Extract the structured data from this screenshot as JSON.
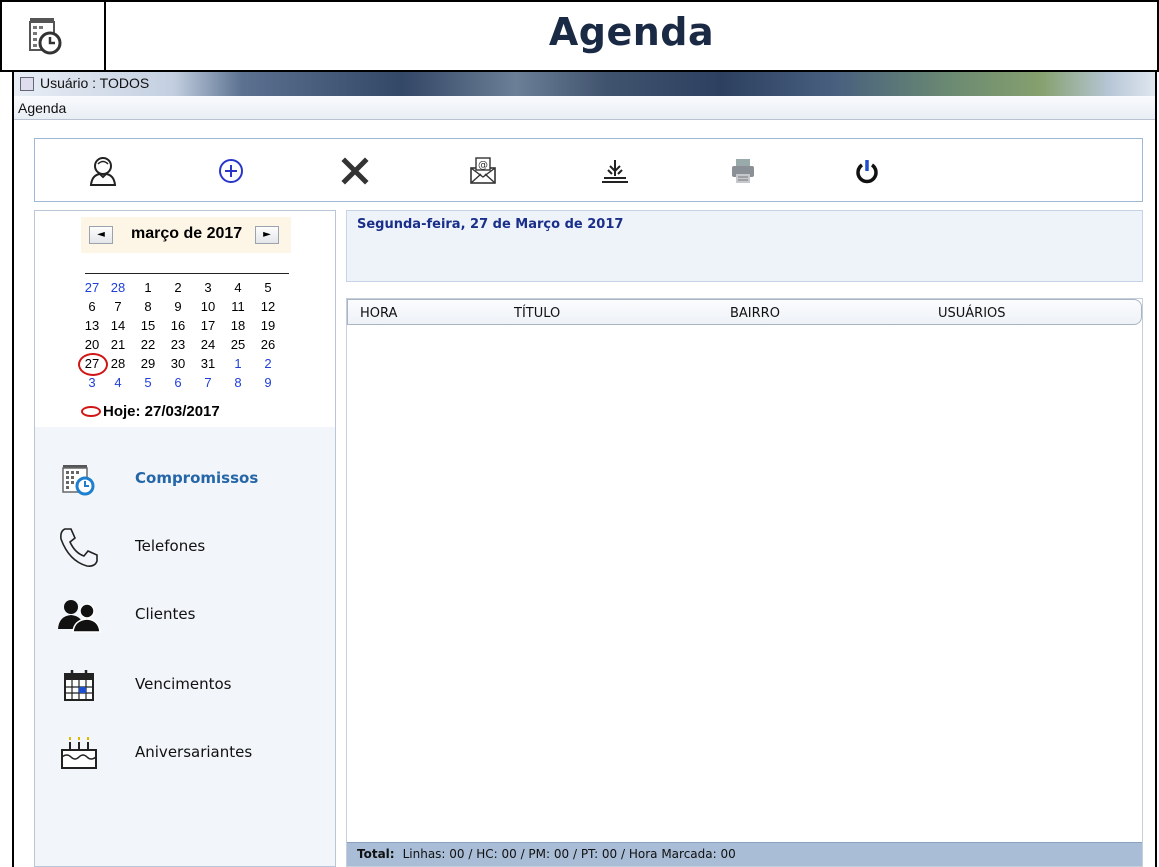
{
  "header": {
    "title": "Agenda",
    "logo_icon": "calendar-clock-icon"
  },
  "window": {
    "title": "Usuário : TODOS"
  },
  "menu": {
    "items": [
      "Agenda"
    ]
  },
  "toolbar": {
    "buttons": [
      {
        "name": "user",
        "icon": "user-icon"
      },
      {
        "name": "add",
        "icon": "add-circle-icon"
      },
      {
        "name": "delete",
        "icon": "close-x-icon"
      },
      {
        "name": "email",
        "icon": "email-icon"
      },
      {
        "name": "sort",
        "icon": "sort-icon"
      },
      {
        "name": "print",
        "icon": "printer-icon"
      },
      {
        "name": "power",
        "icon": "power-icon"
      }
    ]
  },
  "calendar": {
    "month_label": "março de 2017",
    "prev_label": "◄",
    "next_label": "►",
    "weeks": [
      [
        "27",
        "28",
        "1",
        "2",
        "3",
        "4",
        "5"
      ],
      [
        "6",
        "7",
        "8",
        "9",
        "10",
        "11",
        "12"
      ],
      [
        "13",
        "14",
        "15",
        "16",
        "17",
        "18",
        "19"
      ],
      [
        "20",
        "21",
        "22",
        "23",
        "24",
        "25",
        "26"
      ],
      [
        "27",
        "28",
        "29",
        "30",
        "31",
        "1",
        "2"
      ],
      [
        "3",
        "4",
        "5",
        "6",
        "7",
        "8",
        "9"
      ]
    ],
    "today_label": "Hoje: 27/03/2017"
  },
  "sidebar": {
    "items": [
      {
        "label": "Compromissos",
        "icon": "calendar-clock-icon",
        "active": true
      },
      {
        "label": "Telefones",
        "icon": "phone-icon"
      },
      {
        "label": "Clientes",
        "icon": "users-icon"
      },
      {
        "label": "Vencimentos",
        "icon": "calendar-icon"
      },
      {
        "label": "Aniversariantes",
        "icon": "cake-icon"
      }
    ]
  },
  "main": {
    "date_heading": "Segunda-feira, 27 de Março  de 2017",
    "columns": [
      "HORA",
      "TÍTULO",
      "BAIRRO",
      "USUÁRIOS"
    ],
    "rows": [],
    "status_label": "Total:",
    "status_text": "Linhas: 00 / HC: 00 / PM: 00 / PT: 00 / Hora Marcada: 00"
  },
  "colors": {
    "accent": "#2466a8",
    "date_text": "#1a2f8a",
    "today_marker": "#d01515",
    "status_bar": "#a9bdd6"
  }
}
